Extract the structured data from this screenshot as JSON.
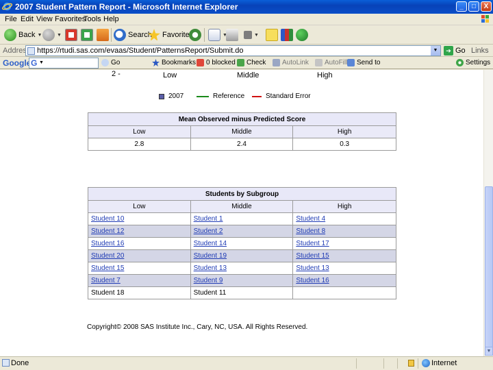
{
  "window": {
    "title": "2007 Student Pattern Report - Microsoft Internet Explorer",
    "buttons": {
      "minimize": "_",
      "maximize": "□",
      "close": "X"
    }
  },
  "menu": [
    "File",
    "Edit",
    "View",
    "Favorites",
    "Tools",
    "Help"
  ],
  "toolbar": {
    "back_label": "Back",
    "search_label": "Search",
    "favorites_label": "Favorites"
  },
  "address": {
    "label": "Address",
    "url": "https://rtudi.sas.com/evaas/Student/PatternsReport/Submit.do",
    "go_label": "Go",
    "links_label": "Links"
  },
  "google_bar": {
    "logo": "Google",
    "search_g": "G",
    "items": [
      "Go",
      "Bookmarks",
      "0 blocked",
      "Check",
      "AutoLink",
      "AutoFill",
      "Send to",
      "Settings"
    ]
  },
  "chart_fragment": {
    "tick_partial": "2 -",
    "categories": [
      "Low",
      "Middle",
      "High"
    ],
    "legend": [
      {
        "label": "2007",
        "color": "#5b5fa8"
      },
      {
        "label": "Reference",
        "color": "#1a8a1a"
      },
      {
        "label": "Standard Error",
        "color": "#d01010"
      }
    ]
  },
  "mean_table": {
    "caption": "Mean Observed minus Predicted Score",
    "headers": [
      "Low",
      "Middle",
      "High"
    ],
    "values": [
      "2.8",
      "2.4",
      "0.3"
    ]
  },
  "subgroup_table": {
    "caption": "Students by Subgroup",
    "headers": [
      "Low",
      "Middle",
      "High"
    ],
    "rows": [
      [
        "Student 10",
        "Student 1",
        "Student 4"
      ],
      [
        "Student 12",
        "Student 2",
        "Student 8"
      ],
      [
        "Student 16",
        "Student 14",
        "Student 17"
      ],
      [
        "Student 20",
        "Student 19",
        "Student 15"
      ],
      [
        "Student 15",
        "Student 13",
        "Student 13"
      ],
      [
        "Student 7",
        "Student 9",
        "Student 16"
      ],
      [
        "Student 18",
        "Student 11",
        ""
      ]
    ]
  },
  "copyright": "Copyright© 2008 SAS Institute Inc., Cary, NC, USA. All Rights Reserved.",
  "status": {
    "text": "Done",
    "zone": "Internet"
  }
}
